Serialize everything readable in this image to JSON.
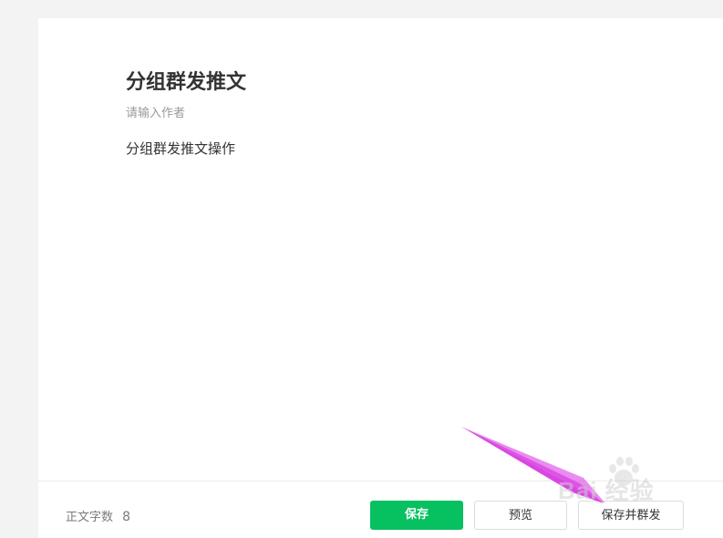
{
  "article": {
    "title": "分组群发推文",
    "author_placeholder": "请输入作者",
    "body": "分组群发推文操作"
  },
  "footer": {
    "word_count_label": "正文字数",
    "word_count_value": "8",
    "save_label": "保存",
    "preview_label": "预览",
    "save_and_publish_label": "保存并群发"
  },
  "watermark": {
    "text": "Bai 经验"
  },
  "colors": {
    "primary_green": "#07c160",
    "annotation_arrow": "#d63ce0"
  },
  "icons": {
    "watermark_logo": "baidu-paw-icon",
    "annotation": "pointer-arrow-icon"
  }
}
